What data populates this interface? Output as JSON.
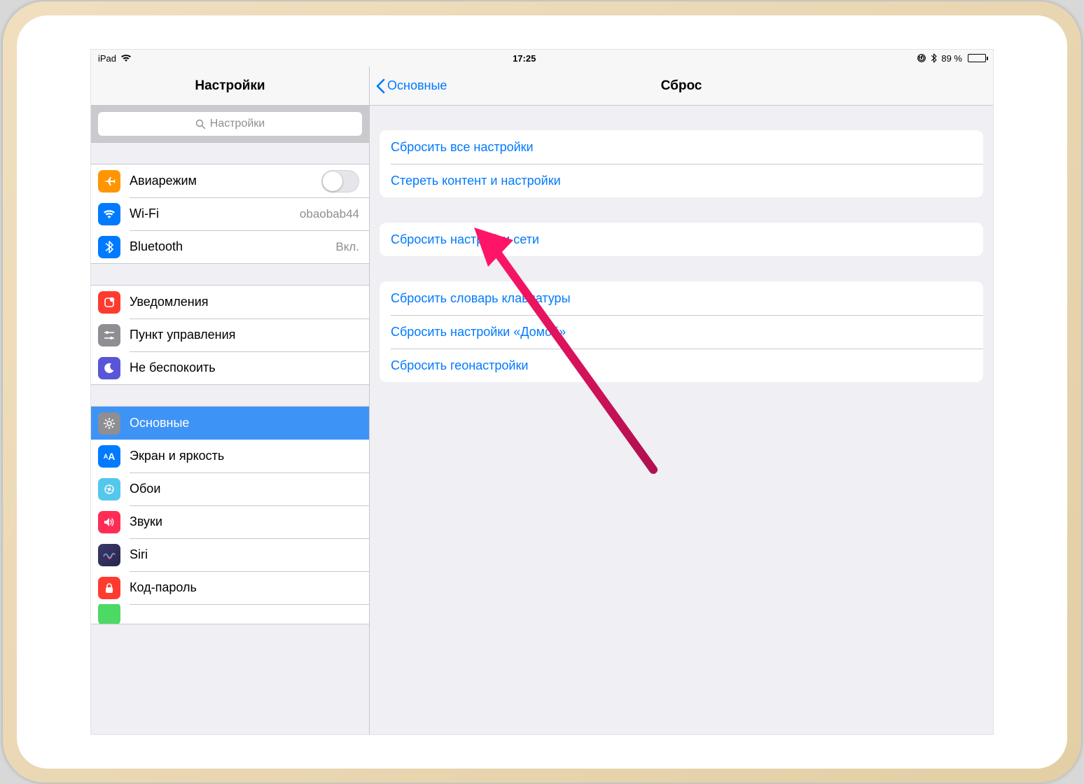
{
  "status": {
    "device": "iPad",
    "time": "17:25",
    "battery_text": "89 %",
    "battery_level": 89
  },
  "sidebar": {
    "title": "Настройки",
    "search_placeholder": "Настройки",
    "groups": [
      {
        "rows": [
          {
            "icon": "airplane",
            "label": "Авиарежим",
            "detail": "",
            "has_switch": true
          },
          {
            "icon": "wifi",
            "label": "Wi-Fi",
            "detail": "obaobab44"
          },
          {
            "icon": "bluetooth",
            "label": "Bluetooth",
            "detail": "Вкл."
          }
        ]
      },
      {
        "rows": [
          {
            "icon": "notifications",
            "label": "Уведомления"
          },
          {
            "icon": "controlcenter",
            "label": "Пункт управления"
          },
          {
            "icon": "dnd",
            "label": "Не беспокоить"
          }
        ]
      },
      {
        "rows": [
          {
            "icon": "general",
            "label": "Основные",
            "selected": true
          },
          {
            "icon": "display",
            "label": "Экран и яркость"
          },
          {
            "icon": "wallpaper",
            "label": "Обои"
          },
          {
            "icon": "sounds",
            "label": "Звуки"
          },
          {
            "icon": "siri",
            "label": "Siri"
          },
          {
            "icon": "passcode",
            "label": "Код-пароль"
          }
        ]
      }
    ]
  },
  "detail": {
    "back_label": "Основные",
    "title": "Сброс",
    "groups": [
      [
        "Сбросить все настройки",
        "Стереть контент и настройки"
      ],
      [
        "Сбросить настройки сети"
      ],
      [
        "Сбросить словарь клавиатуры",
        "Сбросить настройки «Домой»",
        "Сбросить геонастройки"
      ]
    ]
  }
}
